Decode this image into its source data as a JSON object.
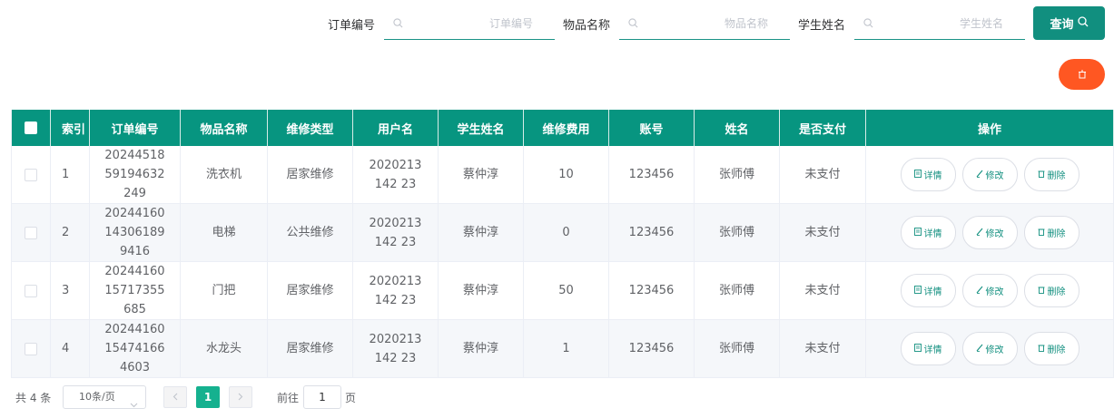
{
  "search": {
    "order_label": "订单编号",
    "order_placeholder": "订单编号",
    "item_label": "物品名称",
    "item_placeholder": "物品名称",
    "student_label": "学生姓名",
    "student_placeholder": "学生姓名",
    "query_label": "查询"
  },
  "table": {
    "headers": {
      "index": "索引",
      "order_no": "订单编号",
      "item_name": "物品名称",
      "repair_type": "维修类型",
      "username": "用户名",
      "student_name": "学生姓名",
      "fee": "维修费用",
      "account": "账号",
      "name": "姓名",
      "paid": "是否支付",
      "ops": "操作"
    },
    "actions": {
      "detail": "详情",
      "edit": "修改",
      "delete": "删除"
    },
    "rows": [
      {
        "index": "1",
        "order_no": "2024451859194632249",
        "item_name": "洗衣机",
        "repair_type": "居家维修",
        "username": "2020213142 23",
        "student_name": "蔡仲淳",
        "fee": "10",
        "account": "123456",
        "name": "张师傅",
        "paid": "未支付"
      },
      {
        "index": "2",
        "order_no": "20244160143061899416",
        "item_name": "电梯",
        "repair_type": "公共维修",
        "username": "2020213142 23",
        "student_name": "蔡仲淳",
        "fee": "0",
        "account": "123456",
        "name": "张师傅",
        "paid": "未支付"
      },
      {
        "index": "3",
        "order_no": "2024416015717355685",
        "item_name": "门把",
        "repair_type": "居家维修",
        "username": "2020213142 23",
        "student_name": "蔡仲淳",
        "fee": "50",
        "account": "123456",
        "name": "张师傅",
        "paid": "未支付"
      },
      {
        "index": "4",
        "order_no": "20244160154741664603",
        "item_name": "水龙头",
        "repair_type": "居家维修",
        "username": "2020213142 23",
        "student_name": "蔡仲淳",
        "fee": "1",
        "account": "123456",
        "name": "张师傅",
        "paid": "未支付"
      }
    ]
  },
  "pager": {
    "total": "共 4 条",
    "page_size": "10条/页",
    "current_page": "1",
    "goto_label": "前往",
    "goto_value": "1",
    "page_word": "页"
  },
  "colors": {
    "primary": "#079580",
    "accent": "#ff5722",
    "page_active": "#15b18f"
  }
}
